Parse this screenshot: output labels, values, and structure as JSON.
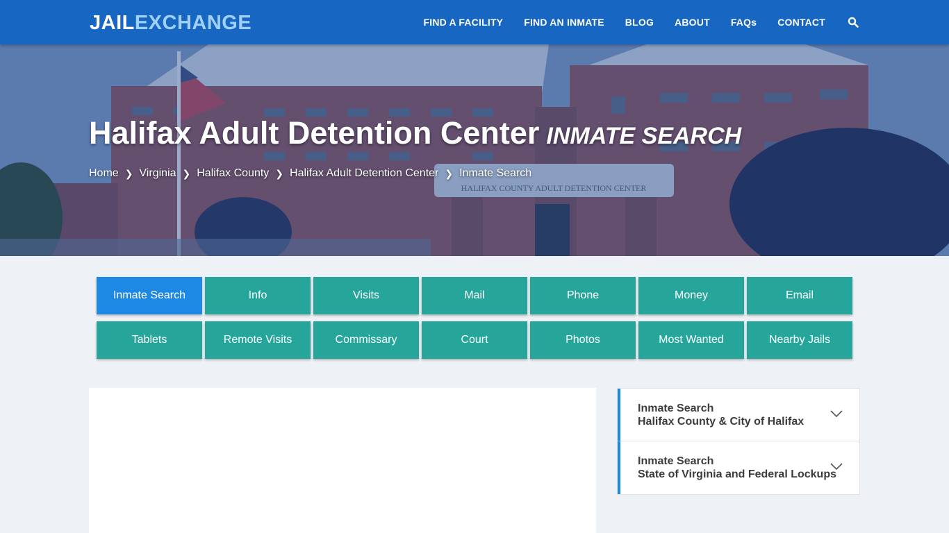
{
  "header": {
    "logo_part1": "JAIL",
    "logo_part2": "EXCHANGE",
    "nav": [
      "FIND A FACILITY",
      "FIND AN INMATE",
      "BLOG",
      "ABOUT",
      "FAQs",
      "CONTACT"
    ],
    "search_icon": "search-icon"
  },
  "hero": {
    "title": "Halifax Adult Detention Center",
    "subtitle": "INMATE SEARCH",
    "breadcrumbs": [
      "Home",
      "Virginia",
      "Halifax County",
      "Halifax Adult Detention Center",
      "Inmate Search"
    ],
    "building_sign": "HALIFAX COUNTY ADULT DETENTION CENTER"
  },
  "tabs": [
    "Inmate Search",
    "Info",
    "Visits",
    "Mail",
    "Phone",
    "Money",
    "Email",
    "Tablets",
    "Remote Visits",
    "Commissary",
    "Court",
    "Photos",
    "Most Wanted",
    "Nearby Jails"
  ],
  "active_tab": "Inmate Search",
  "sidebar": {
    "items": [
      {
        "line1": "Inmate Search",
        "line2": "Halifax County & City of Halifax",
        "icon": "chevron-down-icon"
      },
      {
        "line1": "Inmate Search",
        "line2": "State of Virginia and Federal Lockups",
        "icon": "chevron-down-icon"
      }
    ]
  },
  "colors": {
    "header_bg": "#1766c2",
    "tab_bg": "#26a69a",
    "tab_active_bg": "#1e88e5",
    "page_bg": "#eef1f5",
    "accent_border": "#1e88e5"
  }
}
